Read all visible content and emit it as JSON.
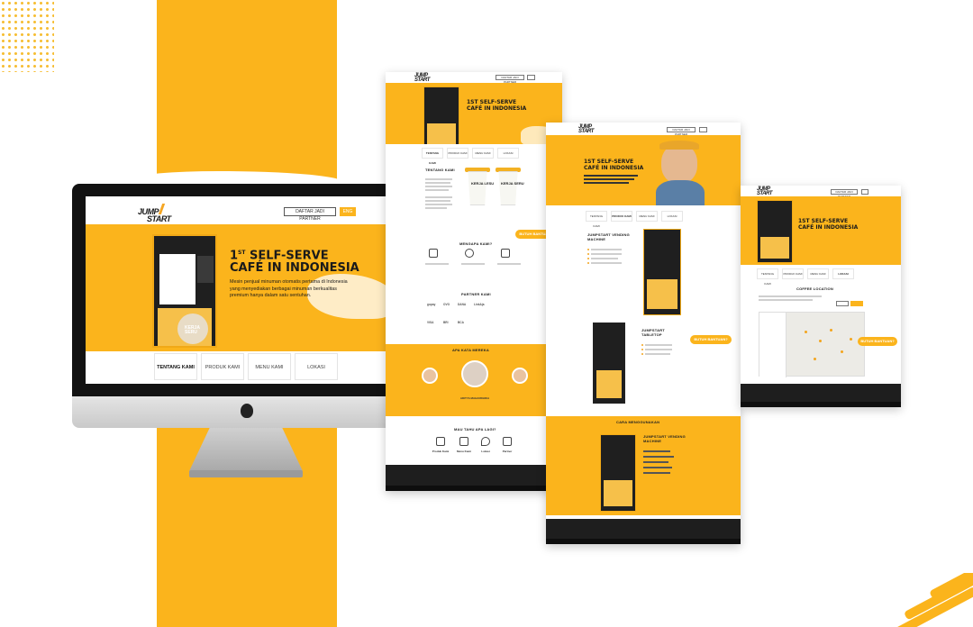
{
  "brand": {
    "logo_line1": "JUMP",
    "logo_line2": "START"
  },
  "desktop": {
    "partner_button": "DAFTAR JADI PARTNER",
    "language_button": "ENG",
    "hero_title_sup": "ST",
    "hero_title_num": "1",
    "hero_title_line1": "SELF-SERVE",
    "hero_title_line2": "CAFÉ IN INDONESIA",
    "hero_description": "Mesin penjual minuman otomatis pertama di Indonesia yang menyediakan berbagai minuman berkualitas premium hanya dalam satu sentuhan.",
    "tabs": [
      "TENTANG KAMI",
      "PRODUK KAMI",
      "MENU KAMI",
      "LOKASI"
    ],
    "active_tab": 0,
    "kiosk_text": [
      "KERJA",
      "LESU",
      "KERJA",
      "SERU"
    ]
  },
  "page1": {
    "partner_button": "DAFTAR JADI PARTNER",
    "title_line1": "1ST SELF-SERVE",
    "title_line2": "CAFÉ IN INDONESIA",
    "tabs": [
      "TENTANG KAMI",
      "PRODUK KAMI",
      "MENU KAMI",
      "LOKASI"
    ],
    "about_title": "TENTANG KAMI",
    "cup_text_1": "KERJA LESU",
    "cup_text_2": "KERJA SERU",
    "why_title": "MENGAPA KAMI?",
    "help_button": "BUTUH BANTUAN?",
    "partners_title": "PARTNER KAMI",
    "partners": [
      "gopay",
      "OVO",
      "DANA",
      "LinkAja",
      "VISA",
      "BRI",
      "BCA"
    ],
    "testimonials_title": "APA KATA MEREKA",
    "testimonial_name": "ADITYA MAHARDHIKA",
    "more_title": "MAU TAHU APA LAGI?",
    "more_items": [
      "Produk Kami",
      "Menu Kami",
      "Lokasi",
      "Partner"
    ]
  },
  "page2": {
    "partner_button": "DAFTAR JADI PARTNER",
    "title_line1": "1ST SELF-SERVE",
    "title_line2": "CAFÉ IN INDONESIA",
    "tabs": [
      "TENTANG KAMI",
      "PRODUK KAMI",
      "MENU KAMI",
      "LOKASI"
    ],
    "product1_title": "JUMPSTART VENDING MACHINE",
    "product2_title": "JUMPSTART TABLETOP",
    "help_button": "BUTUH BANTUAN?",
    "howto_title": "CARA MENGGUNAKAN",
    "howto_product": "JUMPSTART VENDING MACHINE"
  },
  "page3": {
    "partner_button": "DAFTAR JADI PARTNER",
    "title_line1": "1ST SELF-SERVE",
    "title_line2": "CAFÉ IN INDONESIA",
    "tabs": [
      "TENTANG KAMI",
      "PRODUK KAMI",
      "MENU KAMI",
      "LOKASI"
    ],
    "location_title": "COFFEE LOCATION",
    "help_button": "BUTUH BANTUAN?"
  },
  "colors": {
    "brand_yellow": "#fbb41c",
    "dark": "#1e1e1e"
  }
}
